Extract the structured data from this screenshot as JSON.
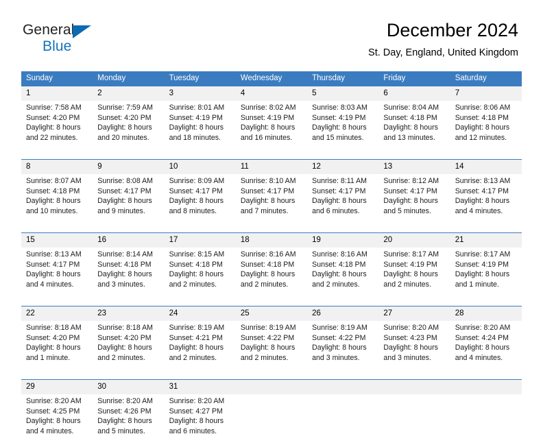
{
  "brand": {
    "name_part1": "General",
    "name_part2": "Blue",
    "logo_icon": "blue-triangle-logo-mark",
    "accent_color": "#1273ba"
  },
  "header": {
    "title": "December 2024",
    "subtitle": "St. Day, England, United Kingdom"
  },
  "calendar": {
    "header_bg": "#3b7cc0",
    "daynum_bg": "#f1f1f1",
    "weekday_headers": [
      "Sunday",
      "Monday",
      "Tuesday",
      "Wednesday",
      "Thursday",
      "Friday",
      "Saturday"
    ],
    "weeks": [
      [
        {
          "day": "1",
          "sunrise": "Sunrise: 7:58 AM",
          "sunset": "Sunset: 4:20 PM",
          "daylight_line1": "Daylight: 8 hours",
          "daylight_line2": "and 22 minutes."
        },
        {
          "day": "2",
          "sunrise": "Sunrise: 7:59 AM",
          "sunset": "Sunset: 4:20 PM",
          "daylight_line1": "Daylight: 8 hours",
          "daylight_line2": "and 20 minutes."
        },
        {
          "day": "3",
          "sunrise": "Sunrise: 8:01 AM",
          "sunset": "Sunset: 4:19 PM",
          "daylight_line1": "Daylight: 8 hours",
          "daylight_line2": "and 18 minutes."
        },
        {
          "day": "4",
          "sunrise": "Sunrise: 8:02 AM",
          "sunset": "Sunset: 4:19 PM",
          "daylight_line1": "Daylight: 8 hours",
          "daylight_line2": "and 16 minutes."
        },
        {
          "day": "5",
          "sunrise": "Sunrise: 8:03 AM",
          "sunset": "Sunset: 4:19 PM",
          "daylight_line1": "Daylight: 8 hours",
          "daylight_line2": "and 15 minutes."
        },
        {
          "day": "6",
          "sunrise": "Sunrise: 8:04 AM",
          "sunset": "Sunset: 4:18 PM",
          "daylight_line1": "Daylight: 8 hours",
          "daylight_line2": "and 13 minutes."
        },
        {
          "day": "7",
          "sunrise": "Sunrise: 8:06 AM",
          "sunset": "Sunset: 4:18 PM",
          "daylight_line1": "Daylight: 8 hours",
          "daylight_line2": "and 12 minutes."
        }
      ],
      [
        {
          "day": "8",
          "sunrise": "Sunrise: 8:07 AM",
          "sunset": "Sunset: 4:18 PM",
          "daylight_line1": "Daylight: 8 hours",
          "daylight_line2": "and 10 minutes."
        },
        {
          "day": "9",
          "sunrise": "Sunrise: 8:08 AM",
          "sunset": "Sunset: 4:17 PM",
          "daylight_line1": "Daylight: 8 hours",
          "daylight_line2": "and 9 minutes."
        },
        {
          "day": "10",
          "sunrise": "Sunrise: 8:09 AM",
          "sunset": "Sunset: 4:17 PM",
          "daylight_line1": "Daylight: 8 hours",
          "daylight_line2": "and 8 minutes."
        },
        {
          "day": "11",
          "sunrise": "Sunrise: 8:10 AM",
          "sunset": "Sunset: 4:17 PM",
          "daylight_line1": "Daylight: 8 hours",
          "daylight_line2": "and 7 minutes."
        },
        {
          "day": "12",
          "sunrise": "Sunrise: 8:11 AM",
          "sunset": "Sunset: 4:17 PM",
          "daylight_line1": "Daylight: 8 hours",
          "daylight_line2": "and 6 minutes."
        },
        {
          "day": "13",
          "sunrise": "Sunrise: 8:12 AM",
          "sunset": "Sunset: 4:17 PM",
          "daylight_line1": "Daylight: 8 hours",
          "daylight_line2": "and 5 minutes."
        },
        {
          "day": "14",
          "sunrise": "Sunrise: 8:13 AM",
          "sunset": "Sunset: 4:17 PM",
          "daylight_line1": "Daylight: 8 hours",
          "daylight_line2": "and 4 minutes."
        }
      ],
      [
        {
          "day": "15",
          "sunrise": "Sunrise: 8:13 AM",
          "sunset": "Sunset: 4:17 PM",
          "daylight_line1": "Daylight: 8 hours",
          "daylight_line2": "and 4 minutes."
        },
        {
          "day": "16",
          "sunrise": "Sunrise: 8:14 AM",
          "sunset": "Sunset: 4:18 PM",
          "daylight_line1": "Daylight: 8 hours",
          "daylight_line2": "and 3 minutes."
        },
        {
          "day": "17",
          "sunrise": "Sunrise: 8:15 AM",
          "sunset": "Sunset: 4:18 PM",
          "daylight_line1": "Daylight: 8 hours",
          "daylight_line2": "and 2 minutes."
        },
        {
          "day": "18",
          "sunrise": "Sunrise: 8:16 AM",
          "sunset": "Sunset: 4:18 PM",
          "daylight_line1": "Daylight: 8 hours",
          "daylight_line2": "and 2 minutes."
        },
        {
          "day": "19",
          "sunrise": "Sunrise: 8:16 AM",
          "sunset": "Sunset: 4:18 PM",
          "daylight_line1": "Daylight: 8 hours",
          "daylight_line2": "and 2 minutes."
        },
        {
          "day": "20",
          "sunrise": "Sunrise: 8:17 AM",
          "sunset": "Sunset: 4:19 PM",
          "daylight_line1": "Daylight: 8 hours",
          "daylight_line2": "and 2 minutes."
        },
        {
          "day": "21",
          "sunrise": "Sunrise: 8:17 AM",
          "sunset": "Sunset: 4:19 PM",
          "daylight_line1": "Daylight: 8 hours",
          "daylight_line2": "and 1 minute."
        }
      ],
      [
        {
          "day": "22",
          "sunrise": "Sunrise: 8:18 AM",
          "sunset": "Sunset: 4:20 PM",
          "daylight_line1": "Daylight: 8 hours",
          "daylight_line2": "and 1 minute."
        },
        {
          "day": "23",
          "sunrise": "Sunrise: 8:18 AM",
          "sunset": "Sunset: 4:20 PM",
          "daylight_line1": "Daylight: 8 hours",
          "daylight_line2": "and 2 minutes."
        },
        {
          "day": "24",
          "sunrise": "Sunrise: 8:19 AM",
          "sunset": "Sunset: 4:21 PM",
          "daylight_line1": "Daylight: 8 hours",
          "daylight_line2": "and 2 minutes."
        },
        {
          "day": "25",
          "sunrise": "Sunrise: 8:19 AM",
          "sunset": "Sunset: 4:22 PM",
          "daylight_line1": "Daylight: 8 hours",
          "daylight_line2": "and 2 minutes."
        },
        {
          "day": "26",
          "sunrise": "Sunrise: 8:19 AM",
          "sunset": "Sunset: 4:22 PM",
          "daylight_line1": "Daylight: 8 hours",
          "daylight_line2": "and 3 minutes."
        },
        {
          "day": "27",
          "sunrise": "Sunrise: 8:20 AM",
          "sunset": "Sunset: 4:23 PM",
          "daylight_line1": "Daylight: 8 hours",
          "daylight_line2": "and 3 minutes."
        },
        {
          "day": "28",
          "sunrise": "Sunrise: 8:20 AM",
          "sunset": "Sunset: 4:24 PM",
          "daylight_line1": "Daylight: 8 hours",
          "daylight_line2": "and 4 minutes."
        }
      ],
      [
        {
          "day": "29",
          "sunrise": "Sunrise: 8:20 AM",
          "sunset": "Sunset: 4:25 PM",
          "daylight_line1": "Daylight: 8 hours",
          "daylight_line2": "and 4 minutes."
        },
        {
          "day": "30",
          "sunrise": "Sunrise: 8:20 AM",
          "sunset": "Sunset: 4:26 PM",
          "daylight_line1": "Daylight: 8 hours",
          "daylight_line2": "and 5 minutes."
        },
        {
          "day": "31",
          "sunrise": "Sunrise: 8:20 AM",
          "sunset": "Sunset: 4:27 PM",
          "daylight_line1": "Daylight: 8 hours",
          "daylight_line2": "and 6 minutes."
        },
        {
          "day": "",
          "sunrise": "",
          "sunset": "",
          "daylight_line1": "",
          "daylight_line2": ""
        },
        {
          "day": "",
          "sunrise": "",
          "sunset": "",
          "daylight_line1": "",
          "daylight_line2": ""
        },
        {
          "day": "",
          "sunrise": "",
          "sunset": "",
          "daylight_line1": "",
          "daylight_line2": ""
        },
        {
          "day": "",
          "sunrise": "",
          "sunset": "",
          "daylight_line1": "",
          "daylight_line2": ""
        }
      ]
    ]
  }
}
